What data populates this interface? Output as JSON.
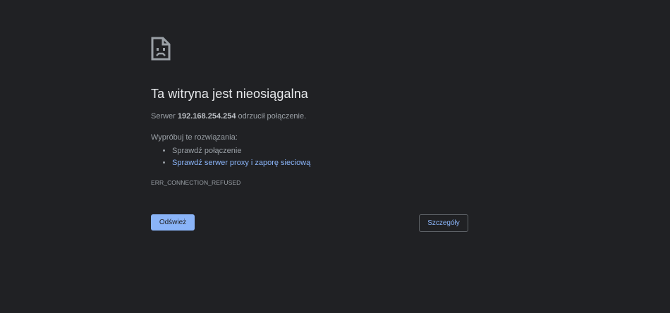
{
  "error": {
    "icon": "sad-page-icon",
    "title": "Ta witryna jest nieosiągalna",
    "summary_prefix": "Serwer ",
    "summary_host": "192.168.254.254",
    "summary_suffix": " odrzucił połączenie.",
    "suggestions_header": "Wypróbuj te rozwiązania:",
    "suggestions": [
      "Sprawdź połączenie",
      "Sprawdź serwer proxy i zaporę sieciową"
    ],
    "code": "ERR_CONNECTION_REFUSED"
  },
  "buttons": {
    "reload_label": "Odśwież",
    "details_label": "Szczegóły"
  },
  "colors": {
    "background": "#202124",
    "title": "#e8eaed",
    "text": "#9aa0a6",
    "link": "#8ab4f8",
    "primary_button": "#8ab4f8"
  }
}
